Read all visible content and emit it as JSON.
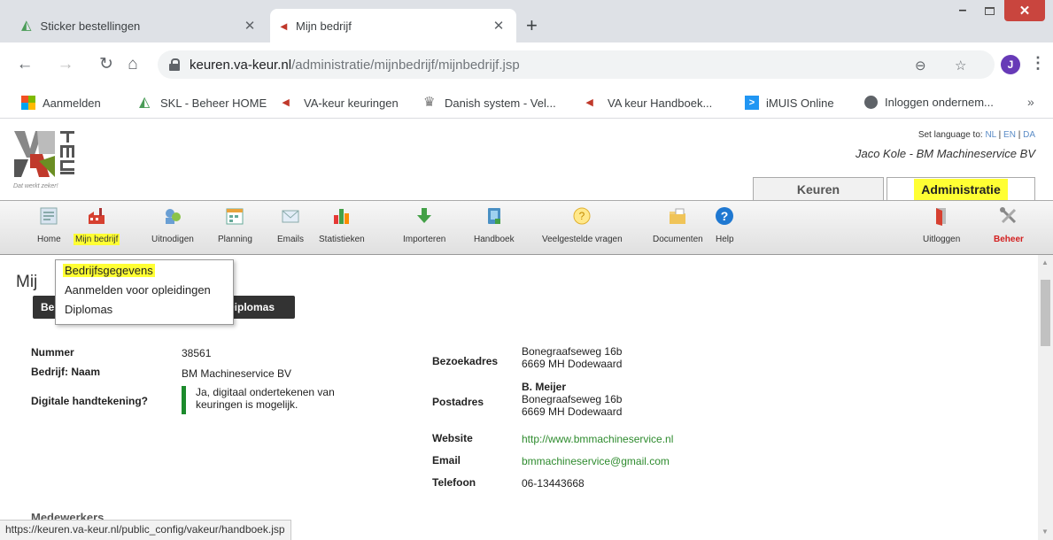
{
  "browser": {
    "tabs": [
      {
        "title": "Sticker bestellingen",
        "active": false,
        "icon": "skl-icon"
      },
      {
        "title": "Mijn bedrijf",
        "active": true,
        "icon": "va-keur-icon"
      }
    ],
    "new_tab": "+",
    "address": {
      "domain": "keuren.va-keur.nl",
      "path": "/administratie/mijnbedrijf/mijnbedrijf.jsp"
    },
    "profile_initial": "J",
    "bookmarks": [
      {
        "label": "Aanmelden",
        "icon": "microsoft-icon"
      },
      {
        "label": "SKL - Beheer HOME",
        "icon": "skl-icon"
      },
      {
        "label": "VA-keur keuringen",
        "icon": "va-keur-icon"
      },
      {
        "label": "Danish system - Vel...",
        "icon": "crown-icon"
      },
      {
        "label": "VA keur Handboek...",
        "icon": "va-keur-icon"
      },
      {
        "label": "iMUIS Online",
        "icon": "imuis-icon"
      },
      {
        "label": "Inloggen ondernem...",
        "icon": "globe-icon"
      }
    ],
    "bookmarks_more": "»",
    "status_url": "https://keuren.va-keur.nl/public_config/vakeur/handboek.jsp"
  },
  "header": {
    "logo_tagline": "Dat werkt zeker!",
    "language_prefix": "Set language to: ",
    "languages": [
      "NL",
      "EN",
      "DA"
    ],
    "user": "Jaco Kole - BM Machineservice BV",
    "tabs": [
      "Keuren",
      "Administratie"
    ]
  },
  "menu": [
    {
      "label": "Home",
      "icon": "home-icon"
    },
    {
      "label": "Mijn bedrijf",
      "icon": "factory-icon"
    },
    {
      "label": "Uitnodigen",
      "icon": "invite-icon"
    },
    {
      "label": "Planning",
      "icon": "calendar-icon"
    },
    {
      "label": "Emails",
      "icon": "email-icon"
    },
    {
      "label": "Statistieken",
      "icon": "bar-chart-icon"
    },
    {
      "label": "Importeren",
      "icon": "import-arrow-icon"
    },
    {
      "label": "Handboek",
      "icon": "book-icon"
    },
    {
      "label": "Veelgestelde vragen",
      "icon": "question-icon"
    },
    {
      "label": "Documenten",
      "icon": "folder-icon"
    },
    {
      "label": "Help",
      "icon": "help-icon"
    },
    {
      "label": "Uitloggen",
      "icon": "logout-door-icon"
    },
    {
      "label": "Beheer",
      "icon": "tools-icon"
    }
  ],
  "content": {
    "title": "Mij",
    "buttons": [
      "Be",
      "Diplomas"
    ],
    "dropdown": [
      "Bedrijfsgegevens",
      "Aanmelden voor opleidingen",
      "Diplomas"
    ],
    "fields": {
      "nummer_label": "Nummer",
      "nummer": "38561",
      "naam_label": "Bedrijf: Naam",
      "naam": "BM Machineservice BV",
      "sig_label": "Digitale handtekening?",
      "sig_line1": "Ja, digitaal ondertekenen van",
      "sig_line2": "keuringen is mogelijk.",
      "bezoek_label": "Bezoekadres",
      "bezoek_line1": "Bonegraafseweg 16b",
      "bezoek_line2": "6669 MH Dodewaard",
      "post_label": "Postadres",
      "post_name": "B. Meijer",
      "post_line1": "Bonegraafseweg 16b",
      "post_line2": "6669 MH Dodewaard",
      "website_label": "Website",
      "website": "http://www.bmmachineservice.nl",
      "email_label": "Email",
      "email": "bmmachineservice@gmail.com",
      "tel_label": "Telefoon",
      "tel": "06-13443668"
    },
    "section": "Medewerkers"
  },
  "colors": {
    "highlight": "#ffff33",
    "green": "#2e8b2e",
    "red": "#d32020"
  }
}
